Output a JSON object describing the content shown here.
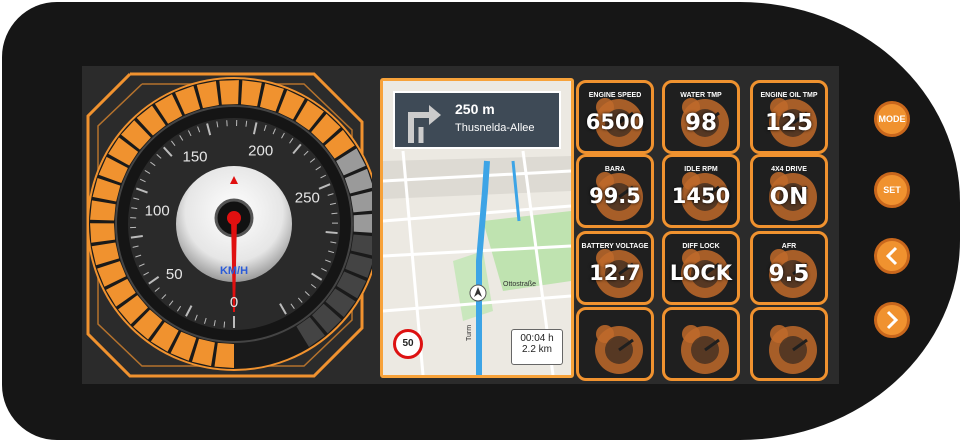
{
  "speedometer": {
    "ticks": [
      "0",
      "50",
      "100",
      "150",
      "200",
      "250"
    ],
    "unit": "KM/H"
  },
  "navigation": {
    "distance": "250 m",
    "street": "Thusnelda-Allee",
    "speed_limit": "50",
    "eta_time": "00:04 h",
    "eta_distance": "2.2 km",
    "map_labels": [
      "Ottostraße",
      "Turm"
    ]
  },
  "tiles": [
    {
      "label": "ENGINE SPEED",
      "value": "6500"
    },
    {
      "label": "WATER TMP",
      "value": "98"
    },
    {
      "label": "ENGINE OIL TMP",
      "value": "125"
    },
    {
      "label": "BARA",
      "value": "99.5"
    },
    {
      "label": "IDLE RPM",
      "value": "1450"
    },
    {
      "label": "4X4 DRIVE",
      "value": "ON"
    },
    {
      "label": "BATTERY VOLTAGE",
      "value": "12.7"
    },
    {
      "label": "DIFF LOCK",
      "value": "LOCK"
    },
    {
      "label": "AFR",
      "value": "9.5"
    },
    {
      "label": "",
      "value": ""
    },
    {
      "label": "",
      "value": ""
    },
    {
      "label": "",
      "value": ""
    }
  ],
  "buttons": {
    "mode": "MODE",
    "set": "SET",
    "prev": "<",
    "next": ">"
  },
  "colors": {
    "accent": "#f0922f",
    "bezel": "#161616",
    "needle": "#e01010"
  }
}
